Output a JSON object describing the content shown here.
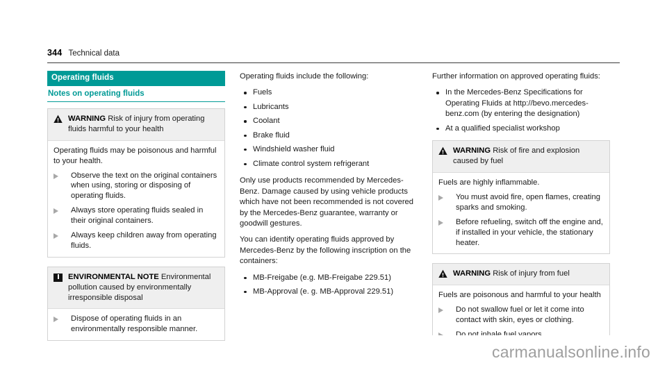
{
  "header": {
    "page_number": "344",
    "section": "Technical data"
  },
  "left_column": {
    "section_title": "Operating fluids",
    "subsection_title": "Notes on operating fluids",
    "warning_box": {
      "icon": "warning-triangle-icon",
      "label": "WARNING",
      "title": "Risk of injury from operating fluids harmful to your health",
      "intro": "Operating fluids may be poisonous and harmful to your health.",
      "actions": [
        "Observe the text on the original containers when using, storing or disposing of operating fluids.",
        "Always store operating fluids sealed in their original containers.",
        "Always keep children away from operating fluids."
      ]
    },
    "environmental_box": {
      "icon": "environmental-note-icon",
      "label": "ENVIRONMENTAL NOTE",
      "title": "Environmental pollution caused by environmentally irresponsible disposal",
      "actions": [
        "Dispose of operating fluids in an environmentally responsible manner."
      ]
    }
  },
  "middle_column": {
    "intro": "Operating fluids include the following:",
    "fluids": [
      "Fuels",
      "Lubricants",
      "Coolant",
      "Brake fluid",
      "Windshield washer fluid",
      "Climate control system refrigerant"
    ],
    "paragraph_1": "Only use products recommended by Mercedes-Benz. Damage caused by using vehicle products which have not been recommended is not covered by the Mercedes-Benz guarantee, warranty or goodwill gestures.",
    "paragraph_2": "You can identify operating fluids approved by Mercedes-Benz by the following inscription on the containers:",
    "inscriptions": [
      "MB-Freigabe (e.g. MB-Freigabe 229.51)",
      "MB-Approval (e. g. MB-Approval 229.51)"
    ]
  },
  "right_column": {
    "intro": "Further information on approved operating fluids:",
    "sources": [
      "In the Mercedes-Benz Specifications for Operating Fluids at http://bevo.mercedes-benz.com (by entering the designation)",
      "At a qualified specialist workshop"
    ],
    "warning_fire": {
      "icon": "warning-triangle-icon",
      "label": "WARNING",
      "title": "Risk of fire and explosion caused by fuel",
      "intro": "Fuels are highly inflammable.",
      "actions": [
        "You must avoid fire, open flames, creating sparks and smoking.",
        "Before refueling, switch off the engine and, if installed in your vehicle, the stationary heater."
      ]
    },
    "warning_injury": {
      "icon": "warning-triangle-icon",
      "label": "WARNING",
      "title": "Risk of injury from fuel",
      "intro": "Fuels are poisonous and harmful to your health",
      "actions": [
        "Do not swallow fuel or let it come into contact with skin, eyes or clothing.",
        "Do not inhale fuel vapors."
      ]
    }
  },
  "watermark": "carmanualsonline.info",
  "colors": {
    "accent_teal": "#009a96",
    "notice_header_gray": "#efefef",
    "bullet_gray": "#a8a8a8"
  }
}
